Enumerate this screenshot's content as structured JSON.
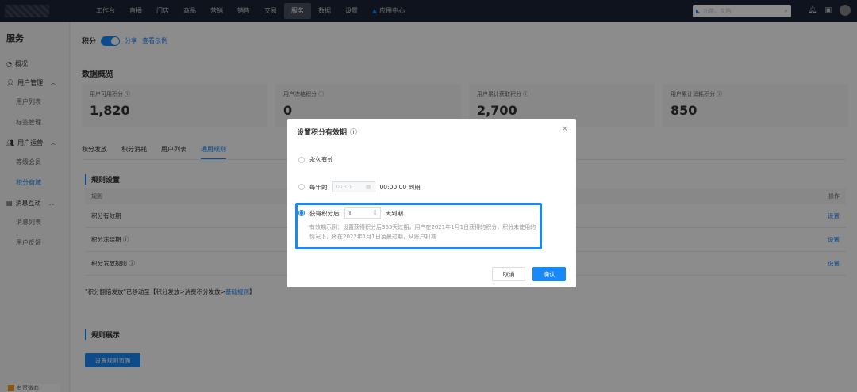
{
  "topbar": {
    "nav": [
      "工作台",
      "直播",
      "门店",
      "商品",
      "营销",
      "销售",
      "交易",
      "服务",
      "数据",
      "设置",
      "应用中心"
    ],
    "active_nav": "服务",
    "search_placeholder": "功能、文档"
  },
  "sidebar": {
    "title": "服务",
    "overview": "概况",
    "user_mgmt": "用户管理",
    "user_list": "用户列表",
    "tag_mgmt": "标签管理",
    "user_ops": "用户运营",
    "level_member": "等级会员",
    "points_mall": "积分商城",
    "msg_interact": "消息互动",
    "msg_list": "消息列表",
    "user_feedback": "用户反馈",
    "footer": "有赞微商"
  },
  "main": {
    "points_label": "积分",
    "share": "分享",
    "view_example": "查看示例",
    "data_overview": "数据概览",
    "cards": [
      {
        "label": "用户可用积分",
        "value": "1,820"
      },
      {
        "label": "用户冻结积分",
        "value": "0"
      },
      {
        "label": "用户累计获取积分",
        "value": "2,700"
      },
      {
        "label": "用户累计消耗积分",
        "value": "850"
      }
    ],
    "tabs": [
      "积分发放",
      "积分消耗",
      "用户列表",
      "通用规则"
    ],
    "rule_settings": "规则设置",
    "col_rule": "规则",
    "col_op": "操作",
    "rows": [
      "积分有效期",
      "积分冻结期",
      "积分发放规则"
    ],
    "set_label": "设置",
    "note_prefix": "\"积分翻倍发放\"已移动至【积分发放>消费积分发放>",
    "note_link": "基础规则",
    "note_suffix": "】",
    "rule_show": "规则展示",
    "rule_page_btn": "设置规则页面"
  },
  "modal": {
    "title": "设置积分有效期",
    "opt_permanent": "永久有效",
    "opt_yearly": "每年的",
    "yearly_date": "01-01",
    "yearly_time": "00:00:00 到期",
    "opt_after": "获得积分后",
    "after_value": "1",
    "after_unit": "天到期",
    "hint": "有效期示例：设置获得积分后365天过期，用户在2021年1月1日获得的积分，积分未使用的情况下，将在2022年1月1日凌晨过期，从账户扣减",
    "cancel": "取消",
    "confirm": "确认"
  },
  "colors": {
    "primary": "#1989fa",
    "topbar": "#1c2438"
  }
}
